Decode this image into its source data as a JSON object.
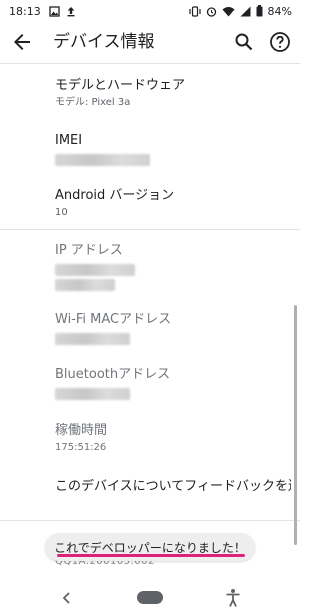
{
  "status_bar": {
    "time": "18:13",
    "battery": "84%",
    "icons": [
      "image-icon",
      "upload-icon",
      "vibrate-icon",
      "alarm-icon",
      "wifi-icon",
      "signal-icon",
      "battery-icon"
    ]
  },
  "app_bar": {
    "title": "デバイス情報",
    "back_icon": "arrow-back-icon",
    "search_icon": "search-icon",
    "help_icon": "help-icon"
  },
  "items": [
    {
      "title": "モデルとハードウェア",
      "subtitle": "モデル: Pixel 3a"
    },
    {
      "title": "IMEI",
      "subtitle": ""
    },
    {
      "title": "Android バージョン",
      "subtitle": "10"
    },
    {
      "title": "IP アドレス",
      "subtitle": ""
    },
    {
      "title": "Wi-Fi MACアドレス",
      "subtitle": ""
    },
    {
      "title": "Bluetoothアドレス",
      "subtitle": ""
    },
    {
      "title": "稼働時間",
      "subtitle": "175:51:26"
    },
    {
      "title": "このデバイスについてフィードバックを送信",
      "subtitle": ""
    }
  ],
  "toast": {
    "text": "これでデベロッパーになりました！"
  },
  "partial_item": {
    "text": "QQ1A.200105.002"
  },
  "colors": {
    "highlight": "#e0217a",
    "divider": "#e3e3e3",
    "secondary_text": "#5f6368"
  }
}
